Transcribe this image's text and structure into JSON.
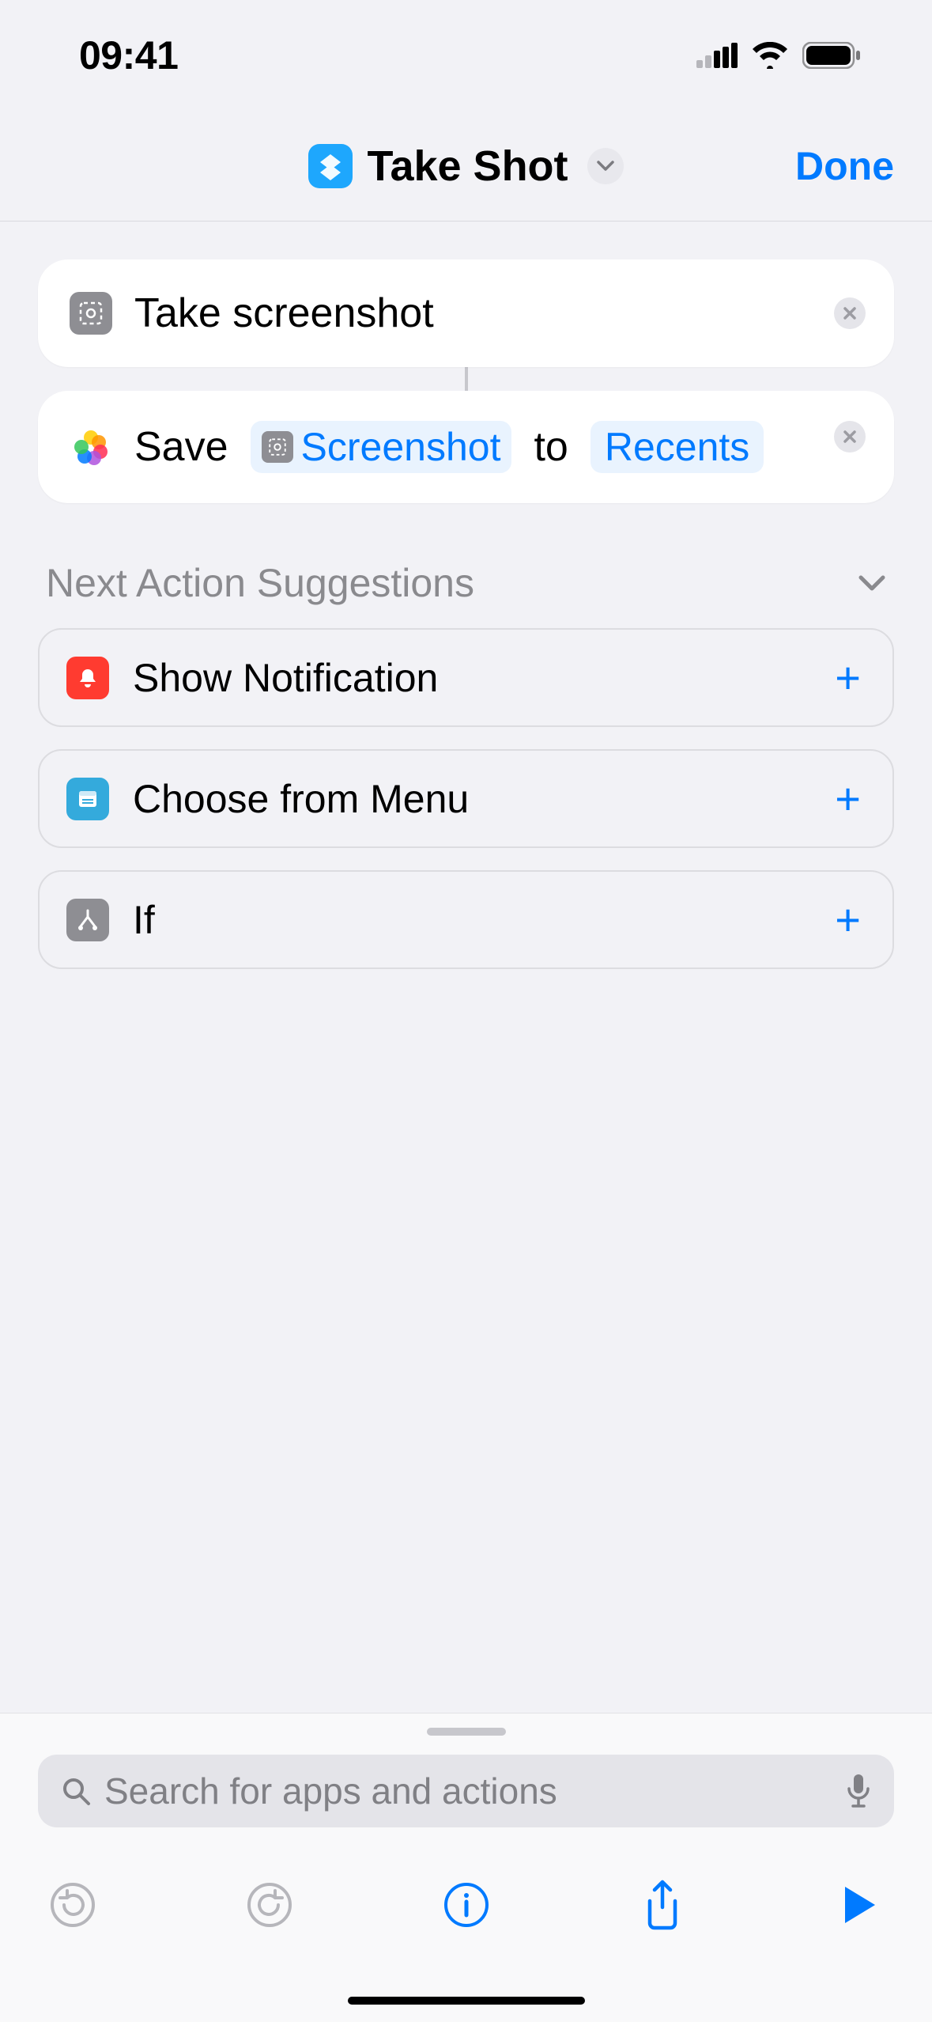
{
  "status": {
    "time": "09:41"
  },
  "nav": {
    "title": "Take Shot",
    "done": "Done"
  },
  "actions": [
    {
      "icon": "screenshot-icon",
      "text": "Take screenshot"
    },
    {
      "icon": "photos-icon",
      "prefix": "Save",
      "variable": "Screenshot",
      "mid": "to",
      "destination": "Recents"
    }
  ],
  "suggestions": {
    "title": "Next Action Suggestions",
    "items": [
      {
        "icon": "notification-icon",
        "label": "Show Notification",
        "color": "#ff3b30"
      },
      {
        "icon": "menu-icon",
        "label": "Choose from Menu",
        "color": "#34aadc"
      },
      {
        "icon": "if-icon",
        "label": "If",
        "color": "#8e8e93"
      }
    ]
  },
  "search": {
    "placeholder": "Search for apps and actions"
  }
}
